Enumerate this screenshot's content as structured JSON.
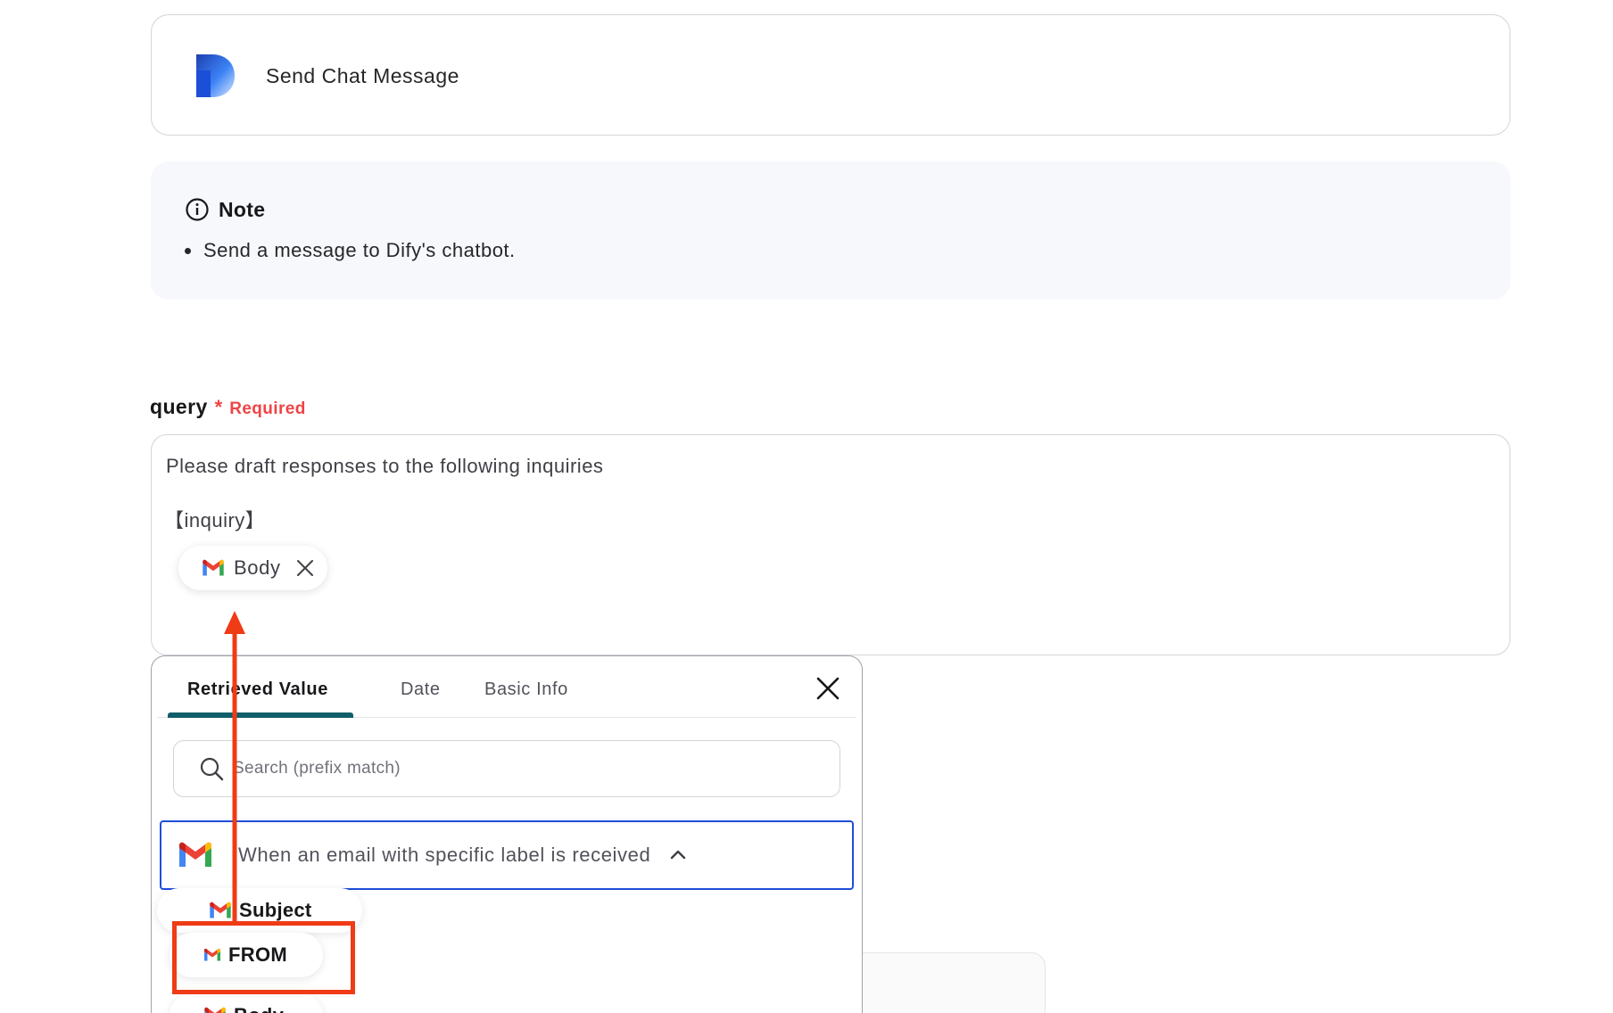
{
  "action": {
    "title": "Send Chat Message",
    "logo": "dify-logo"
  },
  "note": {
    "icon": "info-icon",
    "title": "Note",
    "items": [
      "Send a message to Dify's chatbot."
    ]
  },
  "field": {
    "name": "query",
    "required_marker": "*",
    "required_text": "Required",
    "lines": [
      "Please draft responses to the following inquiries",
      "【inquiry】"
    ],
    "chip": {
      "label": "Body",
      "icon": "gmail-icon"
    }
  },
  "picker": {
    "tabs": [
      {
        "label": "Retrieved Value",
        "active": true
      },
      {
        "label": "Date",
        "active": false
      },
      {
        "label": "Basic Info",
        "active": false
      }
    ],
    "search": {
      "placeholder": "Search (prefix match)"
    },
    "trigger": {
      "label": "When an email with specific label is received",
      "icon": "gmail-icon",
      "expanded": true
    },
    "items": [
      {
        "label": "Subject",
        "icon": "gmail-icon"
      },
      {
        "label": "FROM",
        "icon": "gmail-icon",
        "highlighted": true
      },
      {
        "label": "Body",
        "icon": "gmail-icon"
      }
    ]
  },
  "annotation": {
    "color": "#ef3b16",
    "accent": "#115e6b",
    "focus": "#1d4ed8"
  }
}
